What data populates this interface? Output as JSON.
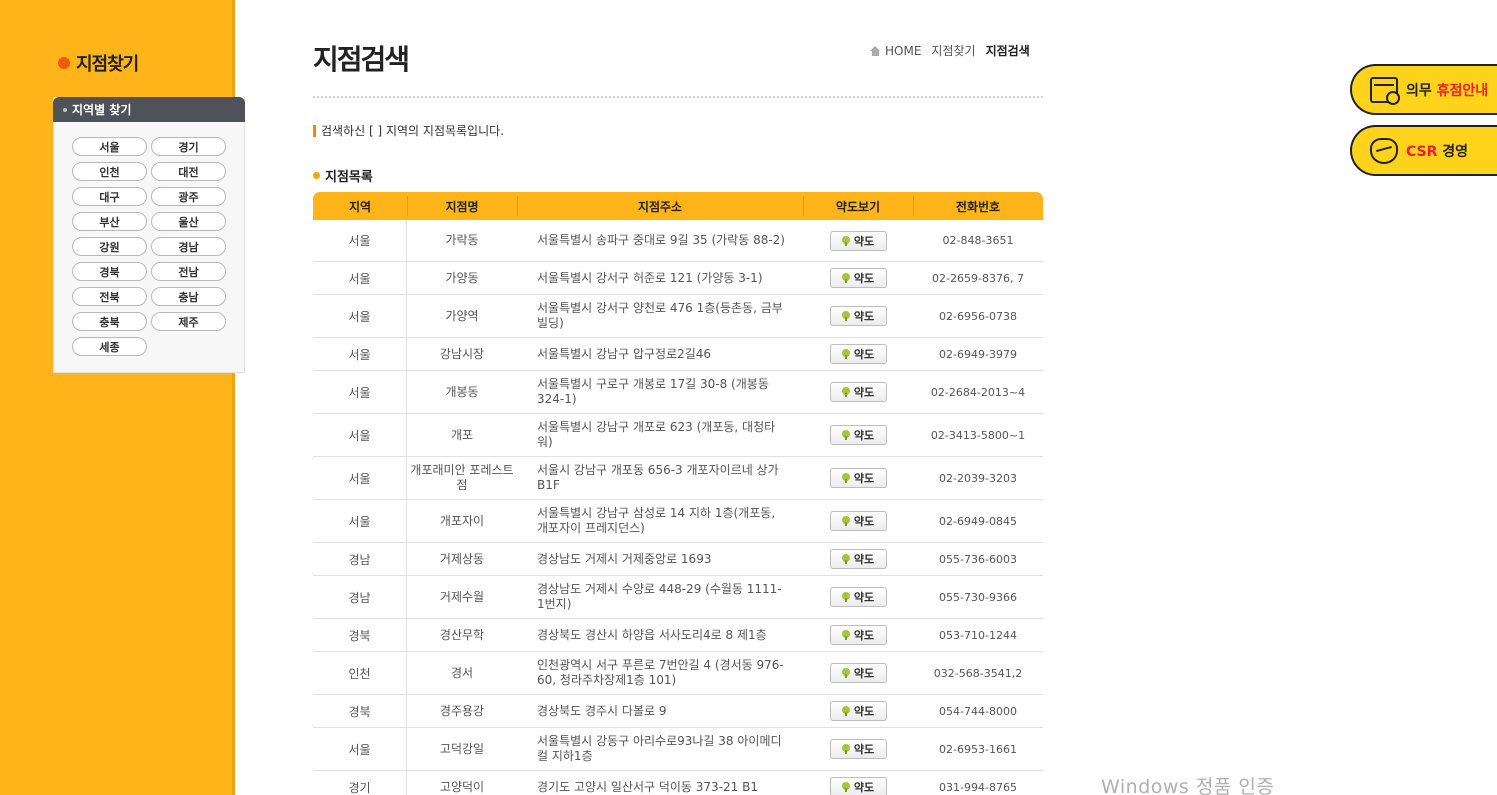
{
  "sidebar": {
    "title": "지점찾기",
    "region_header": "지역별 찾기",
    "regions": [
      "서울",
      "경기",
      "인천",
      "대전",
      "대구",
      "광주",
      "부산",
      "울산",
      "강원",
      "경남",
      "경북",
      "전남",
      "전북",
      "충남",
      "충북",
      "제주",
      "세종"
    ]
  },
  "header": {
    "title": "지점검색",
    "breadcrumb": [
      "HOME",
      "지점찾기",
      "지점검색"
    ]
  },
  "search_message": "검색하신 [ ] 지역의 지점목록입니다.",
  "section_label": "지점목록",
  "table": {
    "columns": [
      "지역",
      "지점명",
      "지점주소",
      "약도보기",
      "전화번호"
    ],
    "map_button_label": "약도",
    "rows": [
      {
        "region": "서울",
        "name": "가락동",
        "address": "서울특별시 송파구 중대로 9길 35 (가락동 88-2)",
        "phone": "02-848-3651"
      },
      {
        "region": "서울",
        "name": "가양동",
        "address": "서울특별시 강서구 허준로 121 (가양동 3-1)",
        "phone": "02-2659-8376, 7"
      },
      {
        "region": "서울",
        "name": "가양역",
        "address": "서울특별시 강서구 양천로 476 1층(등촌동, 금부빌딩)",
        "phone": "02-6956-0738"
      },
      {
        "region": "서울",
        "name": "강남시장",
        "address": "서울특별시 강남구 압구정로2길46",
        "phone": "02-6949-3979"
      },
      {
        "region": "서울",
        "name": "개봉동",
        "address": "서울특별시 구로구 개봉로 17길 30-8 (개봉동 324-1)",
        "phone": "02-2684-2013~4"
      },
      {
        "region": "서울",
        "name": "개포",
        "address": "서울특별시 강남구 개포로 623 (개포동, 대청타워)",
        "phone": "02-3413-5800~1"
      },
      {
        "region": "서울",
        "name": "개포래미안 포레스트점",
        "address": "서울시 강남구 개포동 656-3 개포자이르네 상가 B1F",
        "phone": "02-2039-3203"
      },
      {
        "region": "서울",
        "name": "개포자이",
        "address": "서울특별시 강남구 삼성로 14 지하 1층(개포동, 개포자이 프레지던스)",
        "phone": "02-6949-0845"
      },
      {
        "region": "경남",
        "name": "거제상동",
        "address": "경상남도 거제시 거제중앙로 1693",
        "phone": "055-736-6003"
      },
      {
        "region": "경남",
        "name": "거제수월",
        "address": "경상남도 거제시 수양로 448-29 (수월동 1111-1번지)",
        "phone": "055-730-9366"
      },
      {
        "region": "경북",
        "name": "경산무학",
        "address": "경상북도 경산시 하양읍 서사도리4로 8 제1층",
        "phone": "053-710-1244"
      },
      {
        "region": "인천",
        "name": "경서",
        "address": "인천광역시 서구 푸른로 7번안길 4 (경서동 976-60, 청라주차장제1층 101)",
        "phone": "032-568-3541,2"
      },
      {
        "region": "경북",
        "name": "경주용강",
        "address": "경상북도 경주시 다볼로 9",
        "phone": "054-744-8000"
      },
      {
        "region": "서울",
        "name": "고덕강일",
        "address": "서울특별시 강동구 아리수로93나길 38 아이메디컬 지하1층",
        "phone": "02-6953-1661"
      },
      {
        "region": "경기",
        "name": "고양덕이",
        "address": "경기도 고양시 일산서구 덕이동 373-21 B1",
        "phone": "031-994-8765"
      }
    ]
  },
  "floating": {
    "closure_prefix": "의무 ",
    "closure_accent": "휴점안내",
    "csr_accent": "CSR",
    "csr_suffix": " 경영"
  },
  "watermark": "Windows 정품 인증",
  "colors": {
    "sidebar_bg": "#ffb51a",
    "header_bg": "#ffb51a",
    "accent_red": "#e8212b",
    "float_bg": "#ffd21c"
  }
}
